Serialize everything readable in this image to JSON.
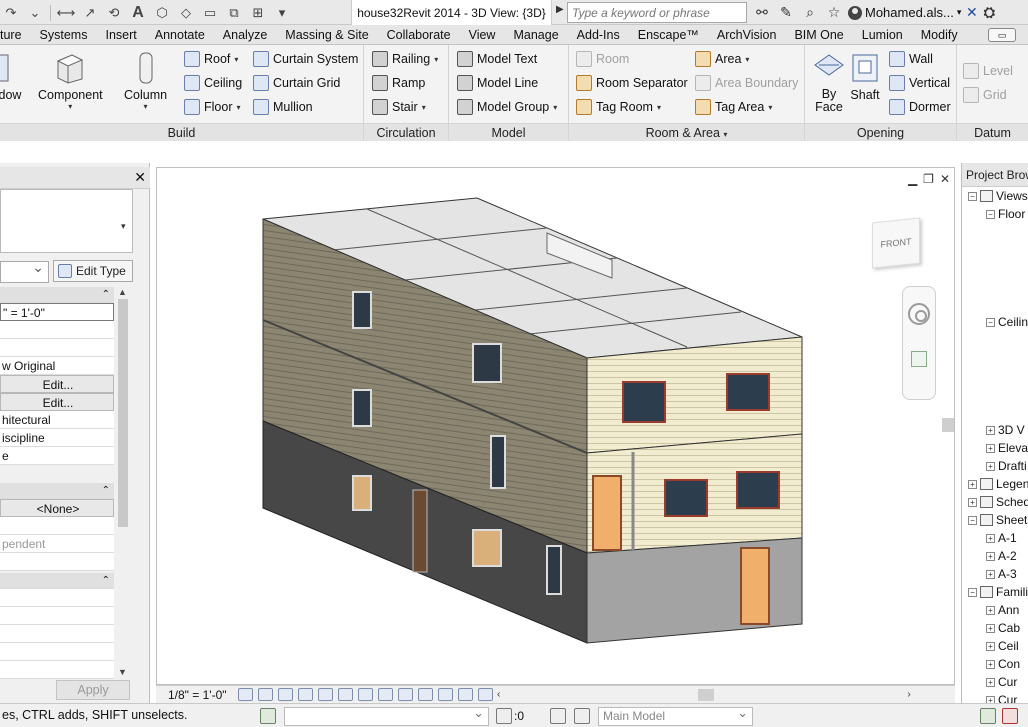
{
  "titlebar": {
    "document_title": "house32Revit 2014 - 3D View: {3D}",
    "search_placeholder": "Type a keyword or phrase",
    "user_name": "Mohamed.als..."
  },
  "ribbon_tabs": [
    "ture",
    "Systems",
    "Insert",
    "Annotate",
    "Analyze",
    "Massing & Site",
    "Collaborate",
    "View",
    "Manage",
    "Add-Ins",
    "Enscape™",
    "ArchVision",
    "BIM One",
    "Lumion",
    "Modify"
  ],
  "ribbon": {
    "build": {
      "label": "Build",
      "window": "dow",
      "component": "Component",
      "column": "Column",
      "roof": "Roof",
      "ceiling": "Ceiling",
      "floor": "Floor",
      "curtain_system": "Curtain System",
      "curtain_grid": "Curtain Grid",
      "mullion": "Mullion"
    },
    "circulation": {
      "label": "Circulation",
      "railing": "Railing",
      "ramp": "Ramp",
      "stair": "Stair"
    },
    "model": {
      "label": "Model",
      "model_text": "Model Text",
      "model_line": "Model Line",
      "model_group": "Model Group"
    },
    "room_area": {
      "label": "Room & Area",
      "room": "Room",
      "room_separator": "Room Separator",
      "tag_room": "Tag Room",
      "area": "Area",
      "area_boundary": "Area Boundary",
      "tag_area": "Tag Area"
    },
    "opening": {
      "label": "Opening",
      "by_face_1": "By",
      "by_face_2": "Face",
      "shaft": "Shaft",
      "wall": "Wall",
      "vertical": "Vertical",
      "dormer": "Dormer"
    },
    "datum": {
      "label": "Datum",
      "level": "Level",
      "grid": "Grid"
    }
  },
  "properties": {
    "edit_type": "Edit Type",
    "rows": [
      {
        "text": "\" = 1'-0\"",
        "kind": "input"
      },
      {
        "text": "",
        "kind": "plain"
      },
      {
        "text": "",
        "kind": "plain"
      },
      {
        "text": "w Original",
        "kind": "plain"
      },
      {
        "text": "Edit...",
        "kind": "btn"
      },
      {
        "text": "Edit...",
        "kind": "btn"
      },
      {
        "text": "hitectural",
        "kind": "plain"
      },
      {
        "text": "iscipline",
        "kind": "plain"
      },
      {
        "text": "e",
        "kind": "plain"
      }
    ],
    "none_value": "<None>",
    "dependent": "pendent",
    "apply": "Apply"
  },
  "viewport": {
    "viewcube_label": "FRONT",
    "scale": "1/8\" = 1'-0\""
  },
  "project_browser": {
    "title": "Project Browser",
    "items": [
      {
        "label": "Views",
        "level": 0
      },
      {
        "label": "Floor",
        "level": 1
      },
      {
        "label": "Ceiling",
        "level": 1
      },
      {
        "label": "3D V",
        "level": 1
      },
      {
        "label": "Eleva",
        "level": 1
      },
      {
        "label": "Drafti",
        "level": 1
      },
      {
        "label": "Legends",
        "level": 0
      },
      {
        "label": "Schedules",
        "level": 0
      },
      {
        "label": "Sheets",
        "level": 0
      },
      {
        "label": "A-1",
        "level": 1
      },
      {
        "label": "A-2",
        "level": 1
      },
      {
        "label": "A-3",
        "level": 1
      },
      {
        "label": "Families",
        "level": 0
      },
      {
        "label": "Ann",
        "level": 1
      },
      {
        "label": "Cab",
        "level": 1
      },
      {
        "label": "Ceil",
        "level": 1
      },
      {
        "label": "Con",
        "level": 1
      },
      {
        "label": "Cur",
        "level": 1
      },
      {
        "label": "Cur",
        "level": 1
      }
    ]
  },
  "statusbar": {
    "hint": "es, CTRL adds, SHIFT unselects.",
    "count": ":0",
    "model": "Main Model"
  }
}
